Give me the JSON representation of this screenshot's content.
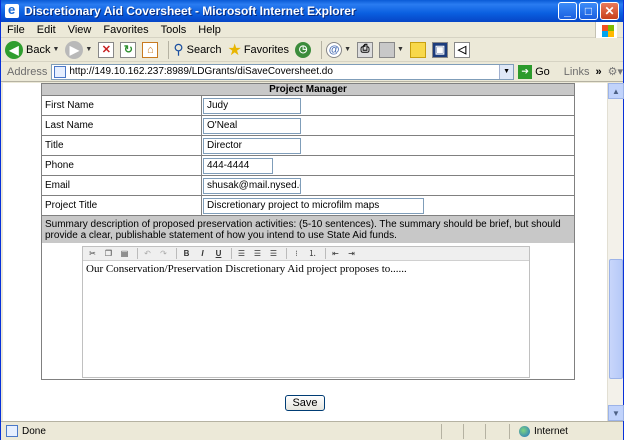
{
  "window": {
    "title": "Discretionary Aid Coversheet - Microsoft Internet Explorer"
  },
  "menu": [
    "File",
    "Edit",
    "View",
    "Favorites",
    "Tools",
    "Help"
  ],
  "toolbar": {
    "back": "Back",
    "search": "Search",
    "favorites": "Favorites"
  },
  "address": {
    "label": "Address",
    "url": "http://149.10.162.237:8989/LDGrants/diSaveCoversheet.do",
    "go": "Go",
    "links": "Links",
    "more": "»"
  },
  "form": {
    "section_title": "Project Manager",
    "fields": [
      {
        "label": "First Name",
        "value": "Judy"
      },
      {
        "label": "Last Name",
        "value": "O'Neal"
      },
      {
        "label": "Title",
        "value": "Director"
      },
      {
        "label": "Phone",
        "value": "444-4444"
      },
      {
        "label": "Email",
        "value": "shusak@mail.nysed.go"
      },
      {
        "label": "Project Title",
        "value": "Discretionary project to microfilm maps"
      }
    ],
    "summary_prompt": "Summary description of proposed preservation activities: (5-10 sentences). The summary should be brief, but should provide a clear, publishable statement of how you intend to use State Aid funds.",
    "summary_text": "Our Conservation/Preservation Discretionary Aid project proposes to......",
    "save": "Save"
  },
  "editor_toolbar": [
    "cut-icon",
    "copy-icon",
    "paste-icon",
    "undo-icon",
    "redo-icon",
    "bold-icon",
    "italic-icon",
    "underline-icon",
    "align-left-icon",
    "align-center-icon",
    "align-right-icon",
    "bullet-list-icon",
    "numbered-list-icon",
    "outdent-icon",
    "indent-icon"
  ],
  "status": {
    "text": "Done",
    "zone": "Internet"
  }
}
